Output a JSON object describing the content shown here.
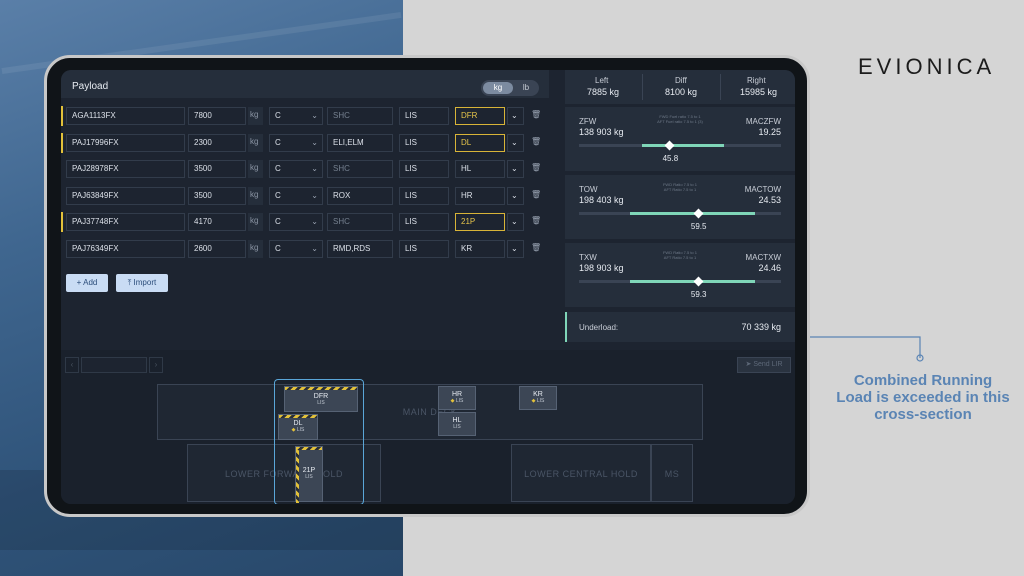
{
  "brand": {
    "logo": "EVIONICA"
  },
  "callout": {
    "text": "Combined Running Load is exceeded in this cross-section"
  },
  "payload": {
    "title": "Payload",
    "units": {
      "active": "kg",
      "inactive": "lb"
    },
    "rows": [
      {
        "awb": "AGA1113FX",
        "weight": "7800",
        "unit": "kg",
        "cls": "C",
        "shc": "SHC",
        "shc_placeholder": true,
        "dest": "LIS",
        "pos": "DFR",
        "flag": true
      },
      {
        "awb": "PAJ17996FX",
        "weight": "2300",
        "unit": "kg",
        "cls": "C",
        "shc": "ELI,ELM",
        "shc_placeholder": false,
        "dest": "LIS",
        "pos": "DL",
        "flag": true
      },
      {
        "awb": "PAJ28978FX",
        "weight": "3500",
        "unit": "kg",
        "cls": "C",
        "shc": "SHC",
        "shc_placeholder": true,
        "dest": "LIS",
        "pos": "HL",
        "flag": false
      },
      {
        "awb": "PAJ63849FX",
        "weight": "3500",
        "unit": "kg",
        "cls": "C",
        "shc": "ROX",
        "shc_placeholder": false,
        "dest": "LIS",
        "pos": "HR",
        "flag": false
      },
      {
        "awb": "PAJ37748FX",
        "weight": "4170",
        "unit": "kg",
        "cls": "C",
        "shc": "SHC",
        "shc_placeholder": true,
        "dest": "LIS",
        "pos": "21P",
        "flag": true
      },
      {
        "awb": "PAJ76349FX",
        "weight": "2600",
        "unit": "kg",
        "cls": "C",
        "shc": "RMD,RDS",
        "shc_placeholder": false,
        "dest": "LIS",
        "pos": "KR",
        "flag": false
      }
    ],
    "add_label": "Add",
    "import_label": "Import"
  },
  "balance": {
    "left_label": "Left",
    "left_value": "7885 kg",
    "diff_label": "Diff",
    "diff_value": "8100 kg",
    "right_label": "Right",
    "right_value": "15985 kg"
  },
  "zfw": {
    "label": "ZFW",
    "value": "138 903 kg",
    "mac_label": "MACZFW",
    "mac_value": "19.25",
    "note1": "FWD Fuel ratio 7.5 to 1",
    "note2": "AFT Fuel ratio 7.5 to 1 (3)",
    "index": "45.8",
    "index_frac": 0.45,
    "range": [
      0.31,
      0.72
    ]
  },
  "tow": {
    "label": "TOW",
    "value": "198 403 kg",
    "mac_label": "MACTOW",
    "mac_value": "24.53",
    "note1": "FWD Ratio 7.5 to 1",
    "note2": "AFT Ratio 7.5 to 1",
    "index": "59.5",
    "index_frac": 0.59,
    "range": [
      0.25,
      0.87
    ]
  },
  "txw": {
    "label": "TXW",
    "value": "198 903 kg",
    "mac_label": "MACTXW",
    "mac_value": "24.46",
    "note1": "FWD Ratio 7.5 to 1",
    "note2": "AFT Ratio 7.5 to 1",
    "index": "59.3",
    "index_frac": 0.59,
    "range": [
      0.25,
      0.87
    ]
  },
  "underload": {
    "label": "Underload:",
    "value": "70 339 kg"
  },
  "map": {
    "send_label": "Send LIR",
    "main_deck": "MAIN DECK",
    "lower_fwd": "LOWER FORWARD HOLD",
    "lower_central": "LOWER CENTRAL HOLD",
    "ms": "MS",
    "ulds": {
      "dfr": {
        "label": "DFR",
        "sub": "LIS"
      },
      "dl": {
        "label": "DL",
        "sub": "LIS"
      },
      "p21": {
        "label": "21P",
        "sub": "LIS"
      },
      "hr": {
        "label": "HR",
        "sub": "LIS"
      },
      "hl": {
        "label": "HL",
        "sub": "LIS"
      },
      "kr": {
        "label": "KR",
        "sub": "LIS"
      }
    }
  }
}
